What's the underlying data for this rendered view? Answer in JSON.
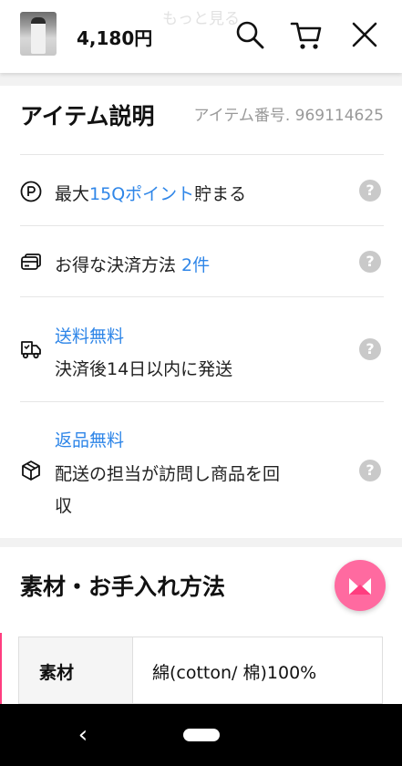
{
  "header": {
    "ghost_text": "もっと見る",
    "price": "4,180円",
    "icons": [
      "search-icon",
      "cart-icon",
      "close-icon"
    ]
  },
  "item_description": {
    "title": "アイテム説明",
    "item_number": "アイテム番号. 969114625",
    "rows": [
      {
        "icon": "point-icon",
        "prefix": "最大",
        "highlight": "15Qポイント",
        "suffix": "貯まる"
      },
      {
        "icon": "card-icon",
        "prefix": "お得な決済方法 ",
        "highlight": "2件",
        "suffix": ""
      },
      {
        "icon": "truck-icon",
        "highlight": "送料無料",
        "line2": "決済後14日以内に発送"
      },
      {
        "icon": "box-icon",
        "highlight": "返品無料",
        "line2": "配送の担当が訪問し商品を回",
        "line3": "収"
      }
    ],
    "help_glyph": "?"
  },
  "material": {
    "title": "素材・お手入れ方法",
    "label": "素材",
    "value": "綿(cotton/ 棉)100%"
  },
  "nav": {
    "back": "‹"
  },
  "colors": {
    "accent_blue": "#2f86e8",
    "fab_pink": "#ff6aa0",
    "help_gray": "#c9c9c9"
  }
}
